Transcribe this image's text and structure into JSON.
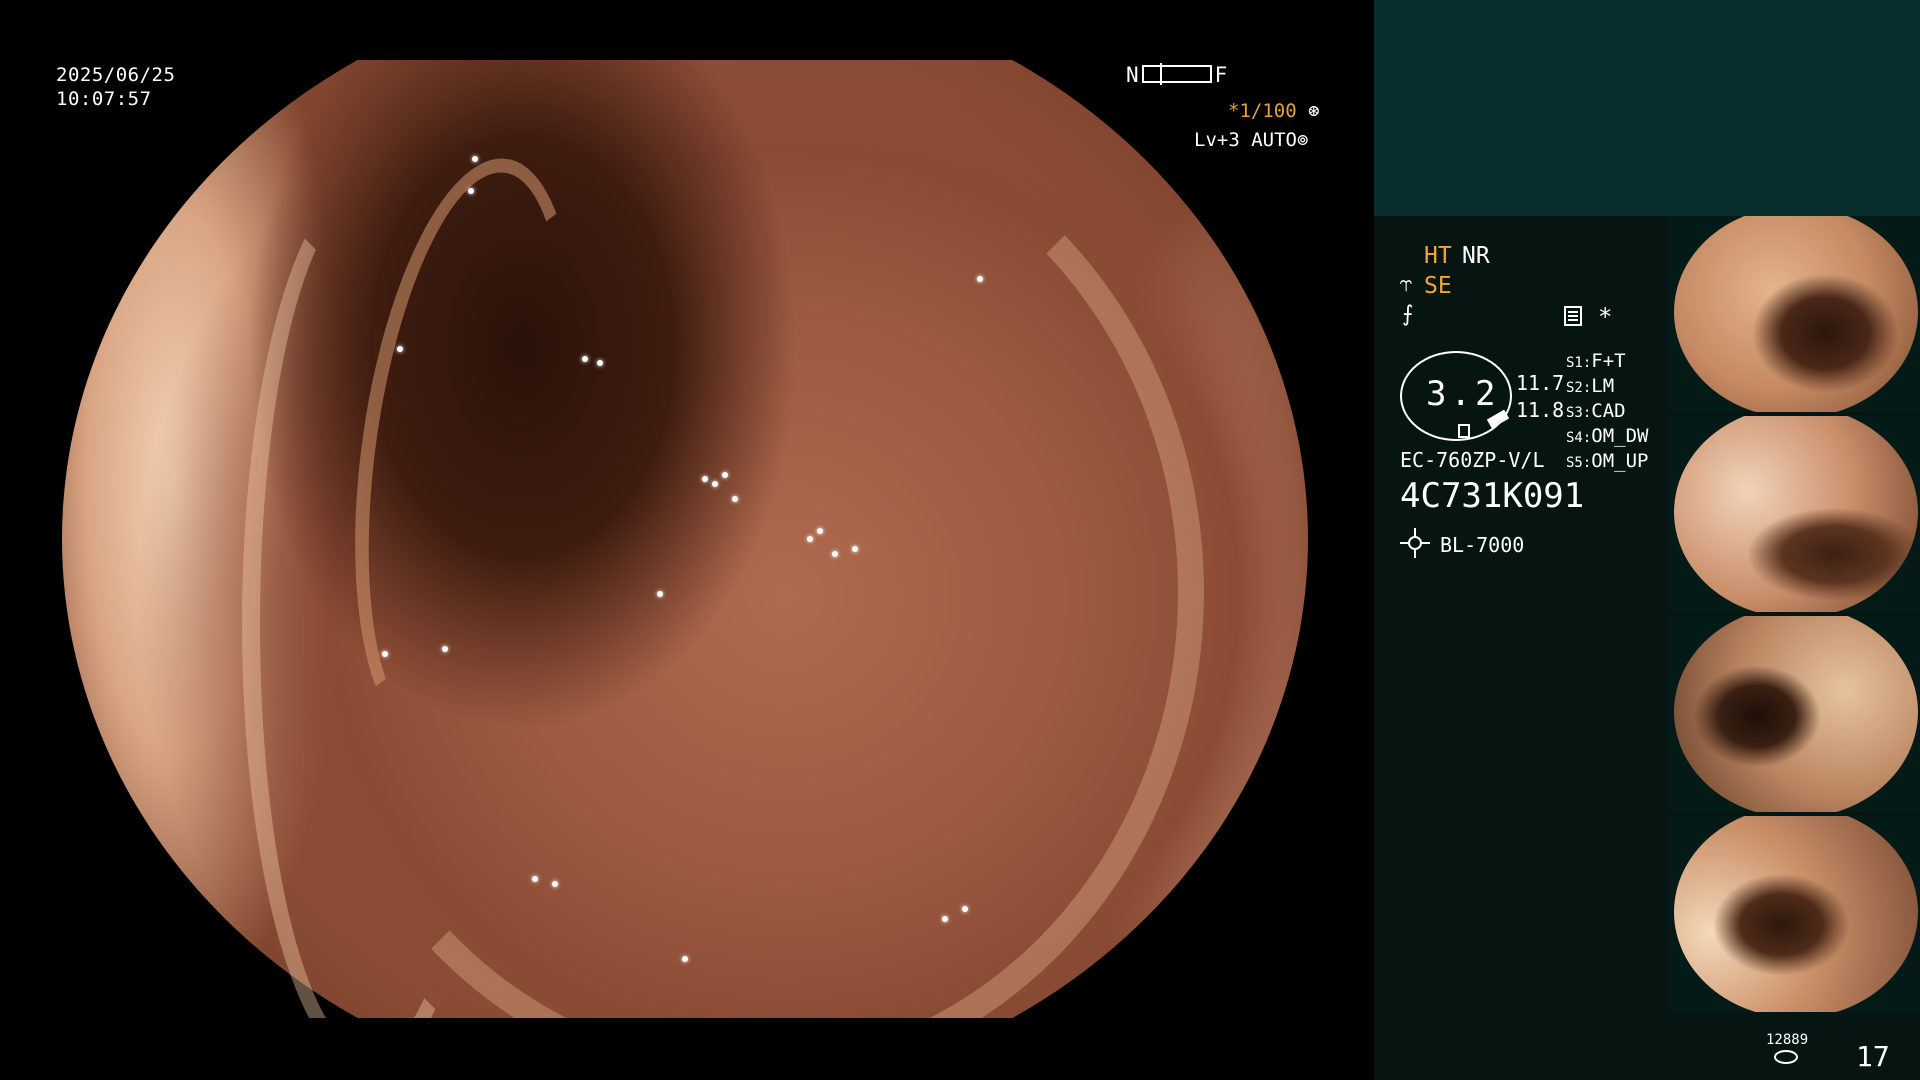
{
  "overlay": {
    "date": "2025/06/25",
    "time": "10:07:57",
    "near_label": "N",
    "far_label": "F",
    "shutter": "*1/100",
    "level": "Lv+3 AUTO"
  },
  "panel": {
    "ht": "HT",
    "nr": "NR",
    "se": "SE",
    "star": "*",
    "gauge_value": "3.2",
    "value_1": "11.7",
    "value_2": "11.8",
    "settings": [
      {
        "key": "S1:",
        "value": "F+T"
      },
      {
        "key": "S2:",
        "value": "LM"
      },
      {
        "key": "S3:",
        "value": "CAD"
      },
      {
        "key": "S4:",
        "value": "OM_DW"
      },
      {
        "key": "S5:",
        "value": "OM_UP"
      }
    ],
    "scope_model": "EC-760ZP-V/L",
    "scope_serial": "4C731K091",
    "light_source": "BL-7000",
    "image_count_small": "12889",
    "image_count": "17"
  },
  "colors": {
    "accent_orange": "#f0a830",
    "panel_top": "#072e2c",
    "panel_body": "#061512"
  },
  "icons": [
    "se-toggle-icon",
    "freeze-icon",
    "document-icon",
    "light-source-icon",
    "disk-icon",
    "iris-icon",
    "auto-icon"
  ]
}
